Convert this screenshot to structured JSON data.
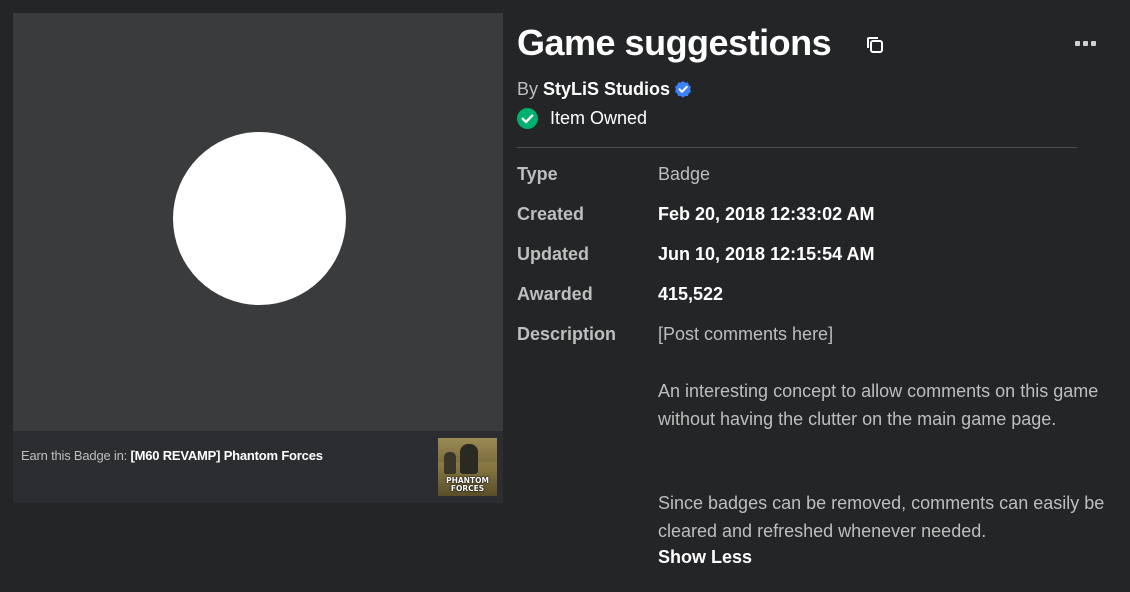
{
  "item": {
    "title": "Game suggestions",
    "by_prefix": "By",
    "creator_name": "StyLiS Studios",
    "owned_label": "Item Owned"
  },
  "thumbnail": {
    "earn_prefix": "Earn this Badge in:",
    "game_name": "[M60 REVAMP] Phantom Forces",
    "game_thumb_text": "PHANTOM FORCES"
  },
  "details": {
    "type_label": "Type",
    "type_value": "Badge",
    "created_label": "Created",
    "created_value": "Feb 20, 2018 12:33:02 AM",
    "updated_label": "Updated",
    "updated_value": "Jun 10, 2018 12:15:54 AM",
    "awarded_label": "Awarded",
    "awarded_value": "415,522",
    "description_label": "Description",
    "description_line1": "[Post comments here]",
    "description_para2": "An interesting concept to allow comments on this game without having the clutter on the main game page.",
    "description_para3": "Since badges can be removed, comments can easily be cleared and refreshed whenever needed.",
    "show_less_label": "Show Less"
  },
  "icons": {
    "copy": "copy-icon",
    "more": "more-options-icon",
    "verified": "verified-badge-icon",
    "owned": "checkmark-circle-icon"
  },
  "colors": {
    "background": "#232527",
    "panel": "#393b3d",
    "verified_blue": "#3b82f6",
    "owned_green": "#00b06f",
    "label_gray": "#bdbebe"
  }
}
